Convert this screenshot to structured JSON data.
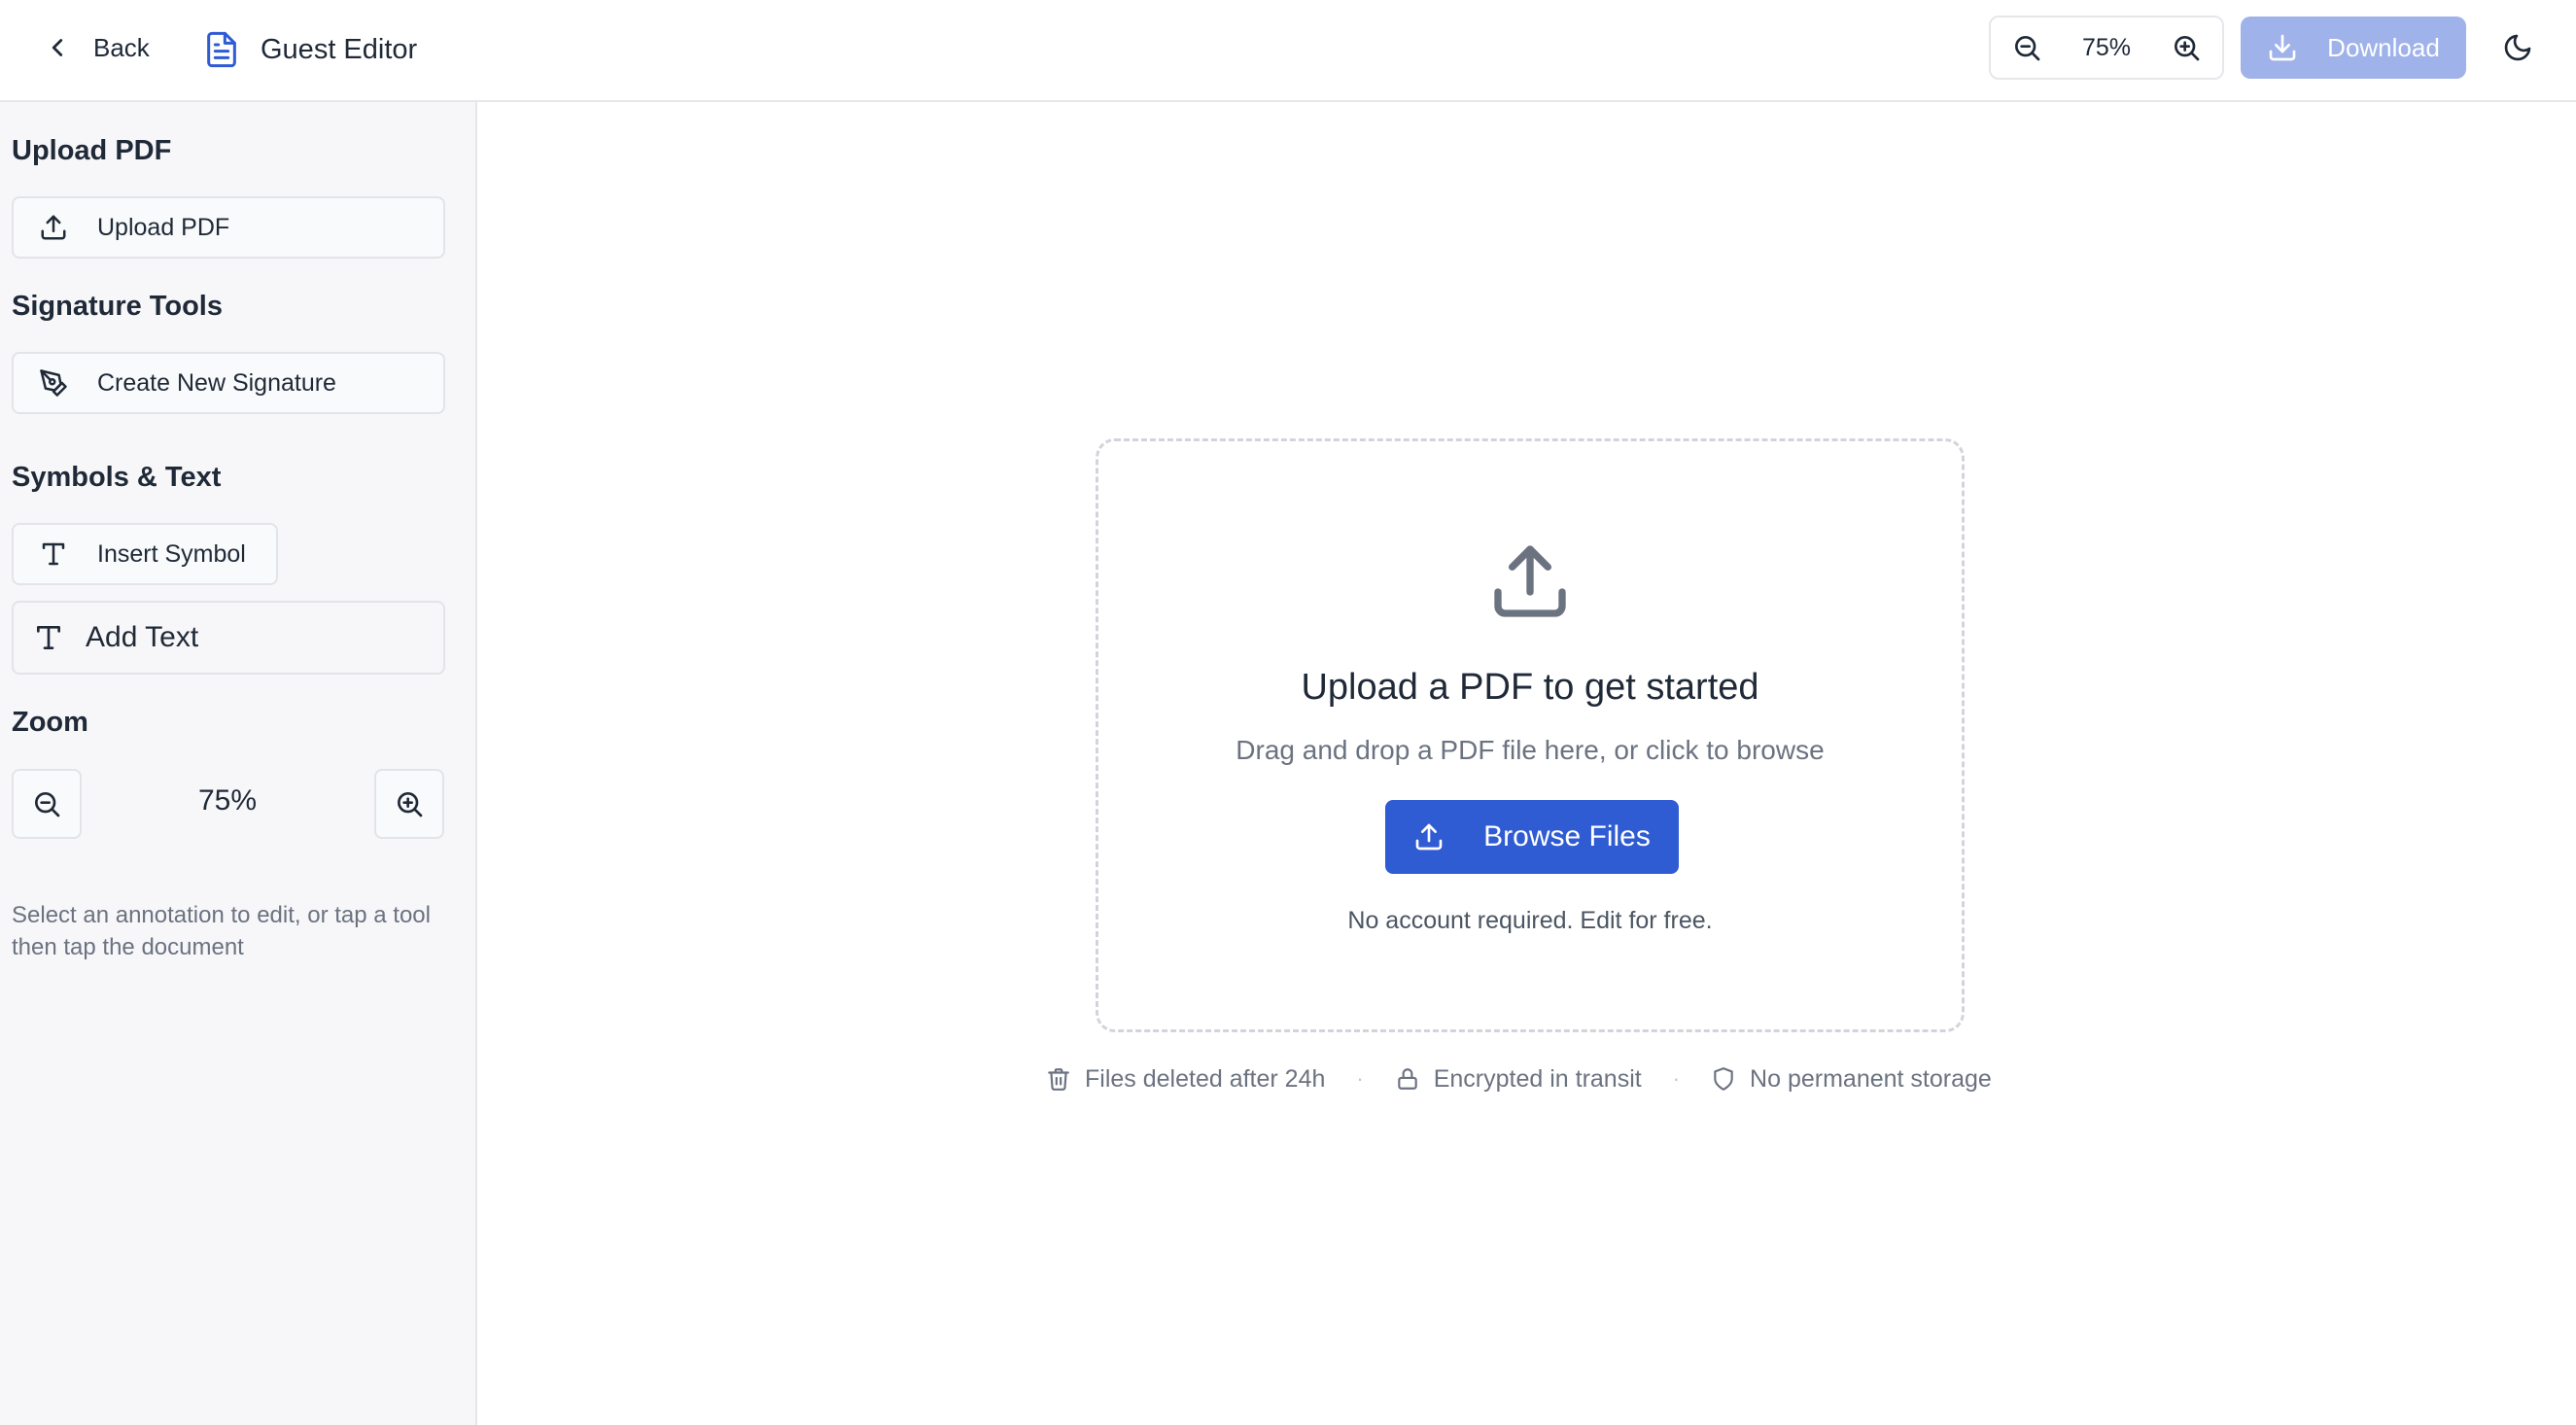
{
  "header": {
    "back_label": "Back",
    "title": "Guest Editor",
    "zoom_value": "75%",
    "download_label": "Download"
  },
  "sidebar": {
    "upload_section_title": "Upload PDF",
    "upload_button_label": "Upload PDF",
    "signature_section_title": "Signature Tools",
    "signature_button_label": "Create New Signature",
    "symbols_section_title": "Symbols & Text",
    "insert_symbol_label": "Insert Symbol",
    "add_text_label": "Add Text",
    "zoom_section_title": "Zoom",
    "zoom_value": "75%",
    "hint": "Select an annotation to edit, or tap a tool then tap the document"
  },
  "main": {
    "dropzone_title": "Upload a PDF to get started",
    "dropzone_subtitle": "Drag and drop a PDF file here, or click to browse",
    "browse_label": "Browse Files",
    "note": "No account required. Edit for free.",
    "trust": {
      "deleted": "Files deleted after 24h",
      "encrypted": "Encrypted in transit",
      "storage": "No permanent storage",
      "separator": "·"
    }
  },
  "colors": {
    "primary": "#2f5bd3",
    "primary_disabled": "#9fb2ea",
    "sidebar_bg": "#f7f7f9",
    "border": "#e5e7eb",
    "muted_text": "#6b7280"
  },
  "icons": {
    "back": "chevron-left-icon",
    "document": "file-text-icon",
    "zoom_out": "zoom-out-icon",
    "zoom_in": "zoom-in-icon",
    "download": "download-icon",
    "theme": "moon-icon",
    "upload": "upload-icon",
    "signature": "pen-tool-icon",
    "text": "type-icon",
    "trash": "trash-icon",
    "lock": "lock-icon",
    "shield": "shield-icon"
  }
}
